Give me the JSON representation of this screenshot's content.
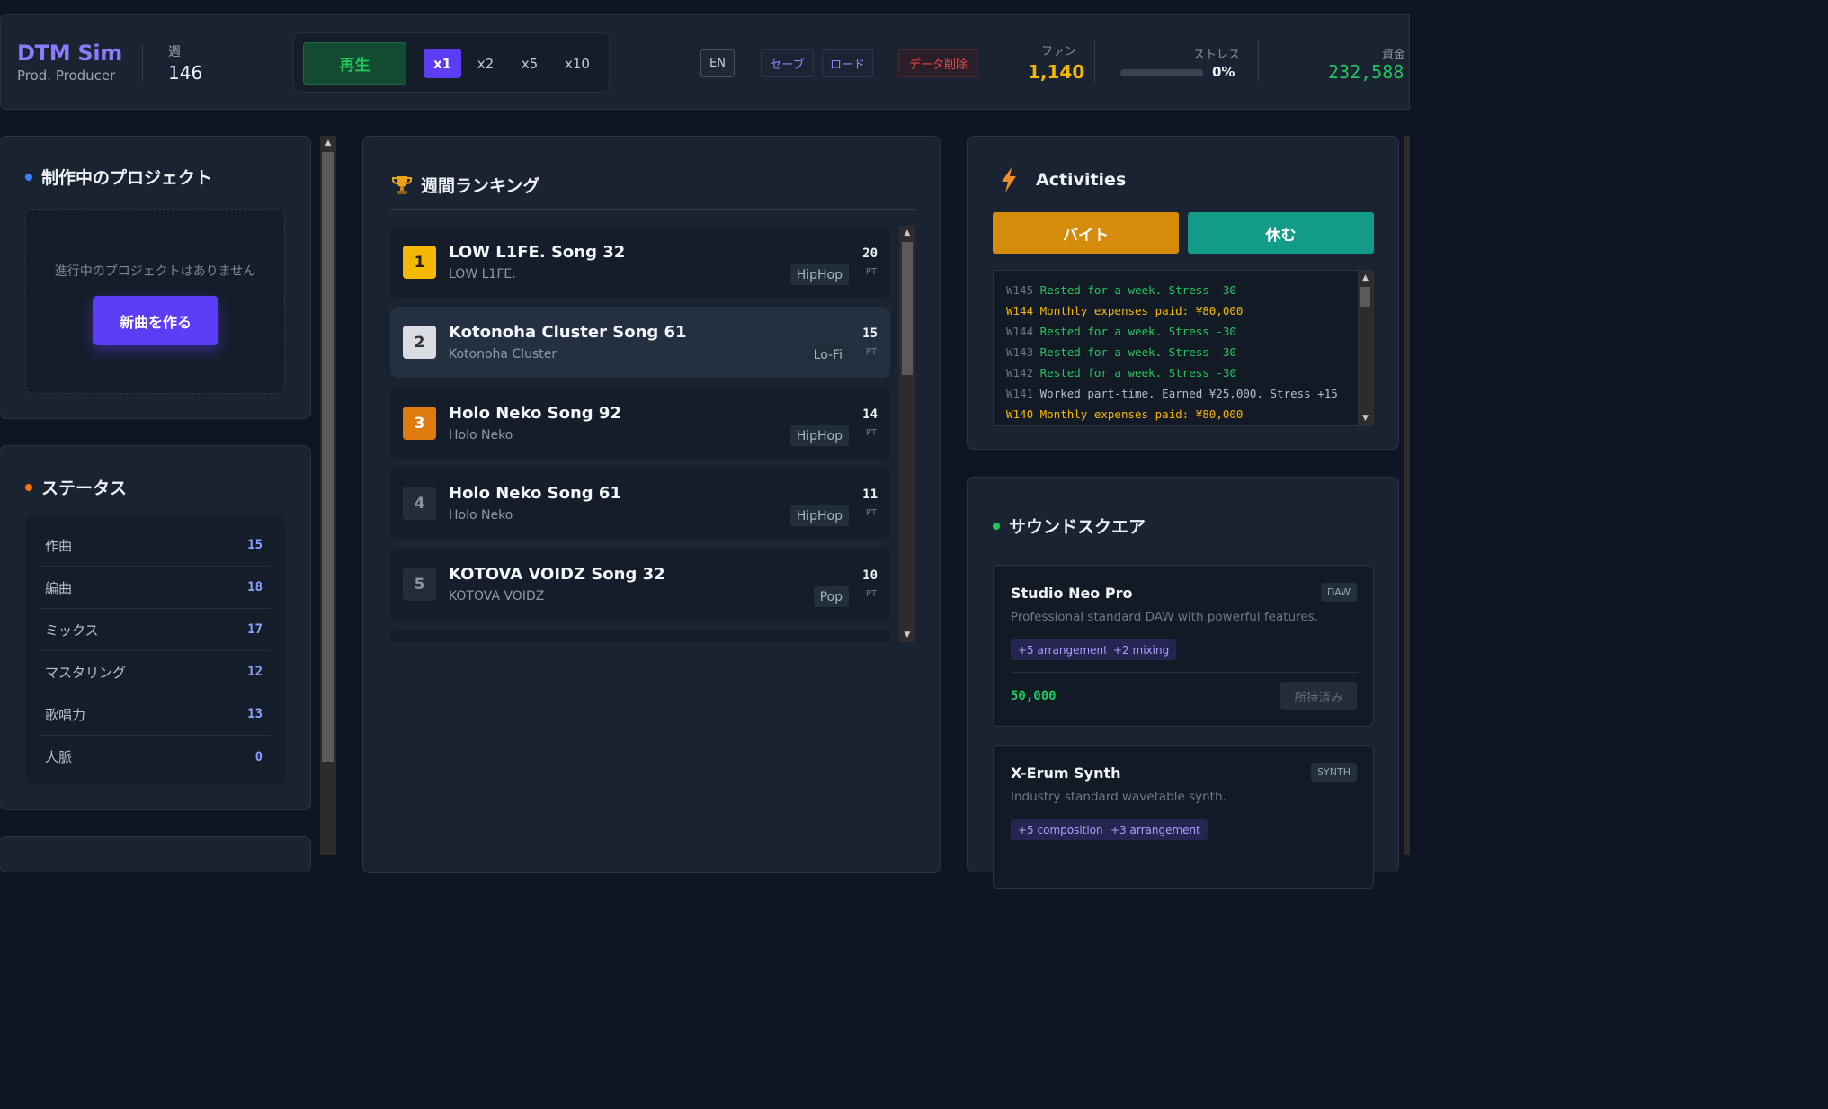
{
  "header": {
    "app_title": "DTM Sim",
    "rank_title": "Prod. Producer",
    "week_label": "週",
    "week_value": "146",
    "play_label": "再生",
    "speeds": [
      "x1",
      "x2",
      "x5",
      "x10"
    ],
    "active_speed": "x1",
    "lang_label": "EN",
    "save_label": "セーブ",
    "load_label": "ロード",
    "delete_label": "データ削除",
    "fans_label": "ファン",
    "fans_value": "1,140",
    "stress_label": "ストレス",
    "stress_value": "0%",
    "stress_fraction": 0,
    "money_label": "資金",
    "money_value": "232,588"
  },
  "projects": {
    "title": "制作中のプロジェクト",
    "empty_text": "進行中のプロジェクトはありません",
    "new_song_label": "新曲を作る"
  },
  "status": {
    "title": "ステータス",
    "rows": [
      {
        "name": "作曲",
        "value": "15"
      },
      {
        "name": "編曲",
        "value": "18"
      },
      {
        "name": "ミックス",
        "value": "17"
      },
      {
        "name": "マスタリング",
        "value": "12"
      },
      {
        "name": "歌唱力",
        "value": "13"
      },
      {
        "name": "人脈",
        "value": "0"
      }
    ]
  },
  "ranking": {
    "title": "週間ランキング",
    "pt_label": "PT",
    "items": [
      {
        "rank": "1",
        "title": "LOW L1FE. Song 32",
        "artist": "LOW L1FE.",
        "genre": "HipHop",
        "points": "20"
      },
      {
        "rank": "2",
        "title": "Kotonoha Cluster Song 61",
        "artist": "Kotonoha Cluster",
        "genre": "Lo-Fi",
        "points": "15"
      },
      {
        "rank": "3",
        "title": "Holo Neko Song 92",
        "artist": "Holo Neko",
        "genre": "HipHop",
        "points": "14"
      },
      {
        "rank": "4",
        "title": "Holo Neko Song 61",
        "artist": "Holo Neko",
        "genre": "HipHop",
        "points": "11"
      },
      {
        "rank": "5",
        "title": "KOTOVA VOIDZ Song 32",
        "artist": "KOTOVA VOIDZ",
        "genre": "Pop",
        "points": "10"
      }
    ]
  },
  "activities": {
    "title": "Activities",
    "work_label": "バイト",
    "rest_label": "休む",
    "log": [
      {
        "week": "W145",
        "text": "Rested for a week. Stress -30",
        "kind": "rest"
      },
      {
        "week": "W144",
        "text": "Monthly expenses paid: ¥80,000",
        "kind": "expense"
      },
      {
        "week": "W144",
        "text": "Rested for a week. Stress -30",
        "kind": "rest"
      },
      {
        "week": "W143",
        "text": "Rested for a week. Stress -30",
        "kind": "rest"
      },
      {
        "week": "W142",
        "text": "Rested for a week. Stress -30",
        "kind": "rest"
      },
      {
        "week": "W141",
        "text": "Worked part-time. Earned ¥25,000. Stress +15",
        "kind": "work"
      },
      {
        "week": "W140",
        "text": "Monthly expenses paid: ¥80,000",
        "kind": "expense"
      }
    ]
  },
  "shop": {
    "title": "サウンドスクエア",
    "items": [
      {
        "name": "Studio Neo Pro",
        "type": "DAW",
        "desc": "Professional standard DAW with powerful features.",
        "tags": [
          "+5 arrangement",
          "+2 mixing"
        ],
        "price": "50,000",
        "status": "所持済み"
      },
      {
        "name": "X-Erum Synth",
        "type": "SYNTH",
        "desc": "Industry standard wavetable synth.",
        "tags": [
          "+5 composition",
          "+3 arrangement"
        ]
      }
    ]
  },
  "colors": {
    "accent": "#5b3df5",
    "green": "#22c55e",
    "gold": "#f5b800",
    "bronze": "#e07b10",
    "work_button": "#d68c0b",
    "rest_button": "#129b86"
  }
}
